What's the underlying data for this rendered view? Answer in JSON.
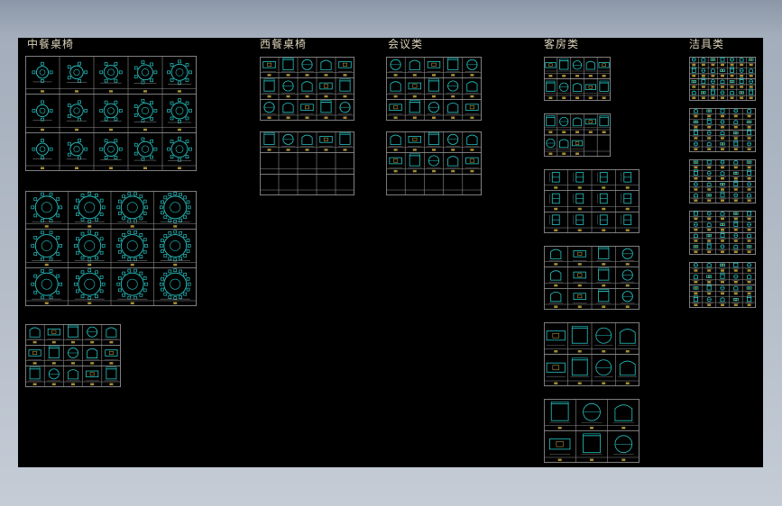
{
  "drawing": {
    "background": "#000000",
    "line_color": "#8c8c8c",
    "symbol_color": "#27c4c4",
    "accent_color": "#d0b040",
    "label_color": "#d8d0b8",
    "categories": [
      {
        "id": "chinese-dining",
        "title": "中餐桌椅"
      },
      {
        "id": "western-dining",
        "title": "西餐桌椅"
      },
      {
        "id": "meeting",
        "title": "会议类"
      },
      {
        "id": "guest-room",
        "title": "客房类"
      },
      {
        "id": "sanitary",
        "title": "洁具类"
      }
    ]
  }
}
